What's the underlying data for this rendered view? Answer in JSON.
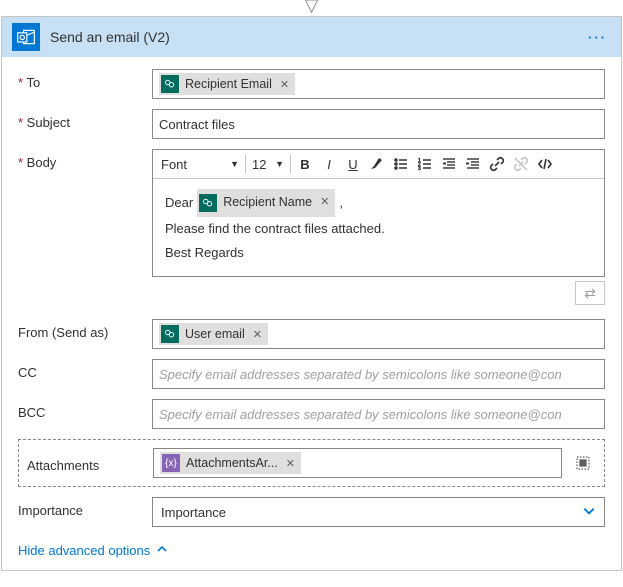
{
  "header": {
    "title": "Send an email (V2)"
  },
  "labels": {
    "to": "To",
    "subject": "Subject",
    "body": "Body",
    "from": "From (Send as)",
    "cc": "CC",
    "bcc": "BCC",
    "attachments": "Attachments",
    "importance": "Importance"
  },
  "tokens": {
    "recipientEmail": "Recipient Email",
    "recipientName": "Recipient Name",
    "userEmail": "User email",
    "attachmentsArr": "AttachmentsAr..."
  },
  "values": {
    "subject": "Contract files"
  },
  "rte": {
    "font": "Font",
    "size": "12",
    "greeting": "Dear",
    "afterGreeting": ",",
    "line1": "Please find the contract files attached.",
    "line2": "Best Regards"
  },
  "placeholders": {
    "cc": "Specify email addresses separated by semicolons like someone@con",
    "bcc": "Specify email addresses separated by semicolons like someone@con"
  },
  "importance": {
    "placeholder": "Importance"
  },
  "links": {
    "hideAdvanced": "Hide advanced options"
  }
}
